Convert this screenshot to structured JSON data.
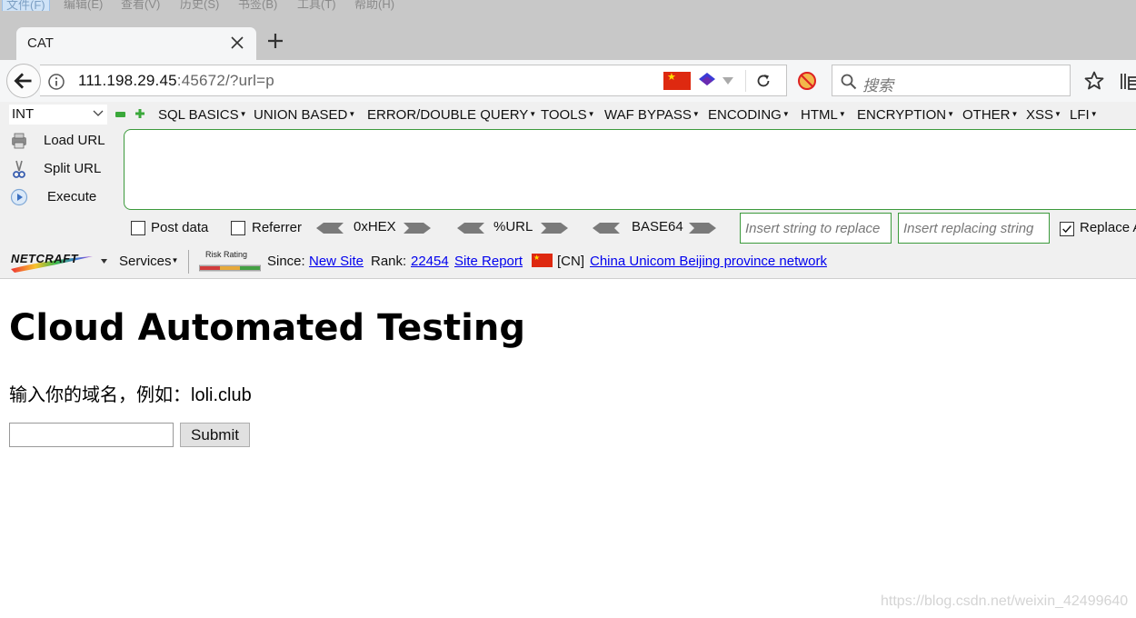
{
  "menubar": {
    "items": [
      "文件(F)",
      "编辑(E)",
      "查看(V)",
      "历史(S)",
      "书签(B)",
      "工具(T)",
      "帮助(H)"
    ]
  },
  "tab": {
    "title": "CAT"
  },
  "urlbar": {
    "host": "111.198.29.45",
    "rest": ":45672/?url=p"
  },
  "searchbar": {
    "placeholder": "搜索"
  },
  "hackbar": {
    "select_value": "INT",
    "menus": [
      "SQL BASICS",
      "UNION BASED",
      "ERROR/DOUBLE QUERY",
      "TOOLS",
      "WAF BYPASS",
      "ENCODING",
      "HTML",
      "ENCRYPTION",
      "OTHER",
      "XSS",
      "LFI"
    ],
    "load_url": "Load URL",
    "split_url": "Split URL",
    "execute": "Execute",
    "post_data": "Post data",
    "referrer": "Referrer",
    "hex": "0xHEX",
    "url_enc": "%URL",
    "base64": "BASE64",
    "replace_placeholder": "Insert string to replace",
    "replacing_placeholder": "Insert replacing string",
    "replace_all": "Replace All"
  },
  "netcraft": {
    "logo": "NETCRAFT",
    "services": "Services",
    "risk_label": "Risk Rating",
    "since_label": "Since:",
    "since_value": "New Site",
    "rank_label": "Rank:",
    "rank_value": "22454",
    "site_report": "Site Report",
    "country": "[CN]",
    "network": "China Unicom Beijing province network"
  },
  "page": {
    "heading": "Cloud Automated Testing",
    "prompt": "输入你的域名，例如：loli.club",
    "input_value": "",
    "submit": "Submit"
  },
  "watermark": "https://blog.csdn.net/weixin_42499640",
  "colors": {
    "chrome": "#c8c8c8",
    "toolbar": "#f5f6f7",
    "hackbar": "#f0f0f0",
    "hackbar_border": "#3c9a3c",
    "link": "#0000ee",
    "flag_red": "#de2910"
  }
}
